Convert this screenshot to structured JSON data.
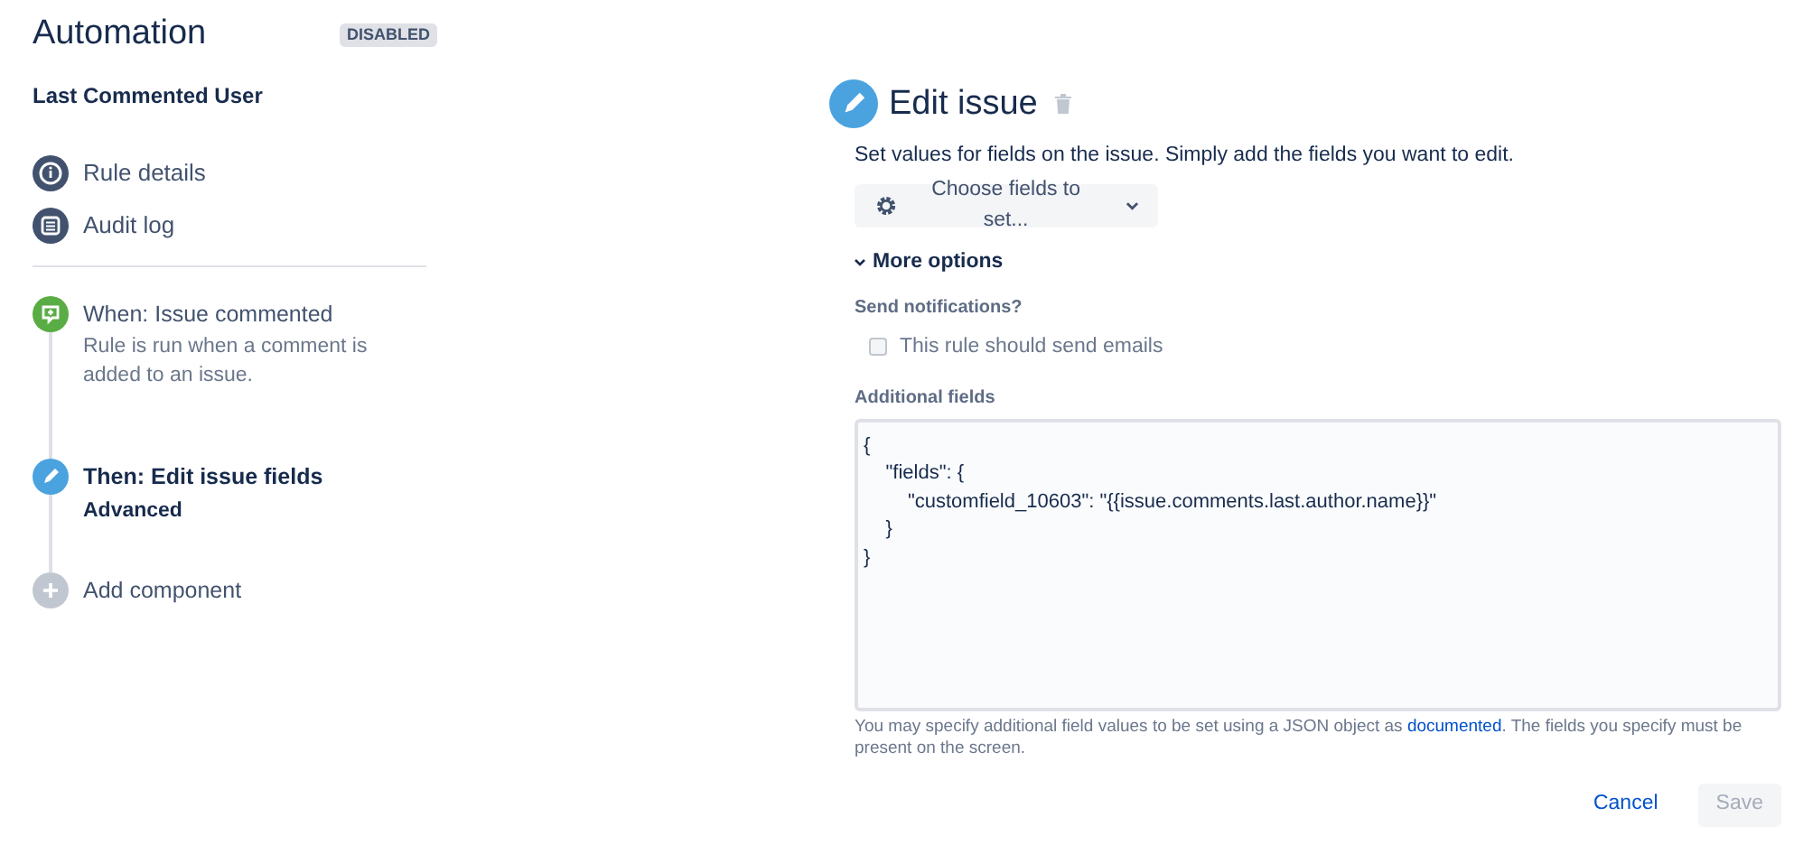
{
  "header": {
    "title": "Automation",
    "status_badge": "DISABLED"
  },
  "rule_name": "Last Commented User",
  "nav_items": [
    {
      "label": "Rule details",
      "kind": "info"
    },
    {
      "label": "Audit log",
      "kind": "log"
    }
  ],
  "steps": [
    {
      "kind": "trigger",
      "title": "When: Issue commented",
      "subtitle": "Rule is run when a comment is added to an issue.",
      "selected": false
    },
    {
      "kind": "action",
      "title": "Then: Edit issue fields",
      "subtitle": "Advanced",
      "selected": true
    },
    {
      "kind": "add",
      "title": "Add component",
      "selected": false
    }
  ],
  "panel": {
    "title": "Edit issue",
    "description": "Set values for fields on the issue. Simply add the fields you want to edit.",
    "choose_button": "Choose fields to set...",
    "more_options": {
      "label": "More options",
      "expanded": true
    },
    "notifications": {
      "label": "Send notifications?",
      "checkbox": {
        "label": "This rule should send emails",
        "checked": false
      }
    },
    "additional_fields": {
      "label": "Additional fields",
      "value": "{\n    \"fields\": {\n        \"customfield_10603\": \"{{issue.comments.last.author.name}}\"\n    }\n}",
      "help_before": "You may specify additional field values to be set using a JSON object as ",
      "help_link": "documented",
      "help_after": ". The fields you specify must be present on the screen."
    },
    "buttons": [
      {
        "label": "Cancel",
        "kind": "link",
        "disabled": false
      },
      {
        "label": "Save",
        "kind": "primary",
        "disabled": true
      }
    ]
  }
}
